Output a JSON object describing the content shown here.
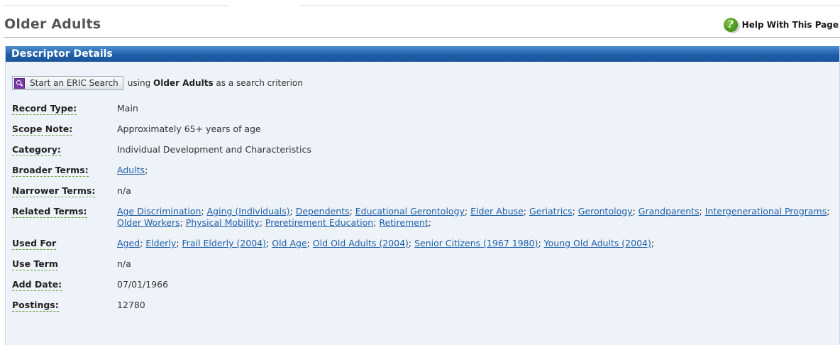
{
  "page": {
    "title": "Older Adults",
    "help_label": "Help With This Page"
  },
  "panel": {
    "header": "Descriptor Details"
  },
  "search": {
    "button_label": "Start an ERIC Search",
    "prefix": "using",
    "term": "Older Adults",
    "suffix": "as a search criterion"
  },
  "details": {
    "record_type": {
      "label": "Record Type:",
      "value": "Main"
    },
    "scope_note": {
      "label": "Scope Note:",
      "value": "Approximately 65+ years of age"
    },
    "category": {
      "label": "Category:",
      "value": "Individual Development and Characteristics"
    },
    "broader_terms": {
      "label": "Broader Terms:",
      "links": [
        "Adults"
      ]
    },
    "narrower_terms": {
      "label": "Narrower Terms:",
      "value": "n/a"
    },
    "related_terms": {
      "label": "Related Terms:",
      "links": [
        "Age Discrimination",
        "Aging (Individuals)",
        "Dependents",
        "Educational Gerontology",
        "Elder Abuse",
        "Geriatrics",
        "Gerontology",
        "Grandparents",
        "Intergenerational Programs",
        "Older Workers",
        "Physical Mobility",
        "Preretirement Education",
        "Retirement"
      ]
    },
    "used_for": {
      "label": "Used For",
      "links": [
        "Aged",
        "Elderly",
        "Frail Elderly (2004)",
        "Old Age",
        "Old Old Adults (2004)",
        "Senior Citizens (1967 1980)",
        "Young Old Adults (2004)"
      ]
    },
    "use_term": {
      "label": "Use Term",
      "value": "n/a"
    },
    "add_date": {
      "label": "Add Date:",
      "value": "07/01/1966"
    },
    "postings": {
      "label": "Postings:",
      "value": "12780"
    }
  },
  "colors": {
    "panel_bg": "#eef3f9",
    "header_blue": "#1e5fa8",
    "link_blue": "#1f5fa6",
    "help_green": "#2c7a10"
  }
}
